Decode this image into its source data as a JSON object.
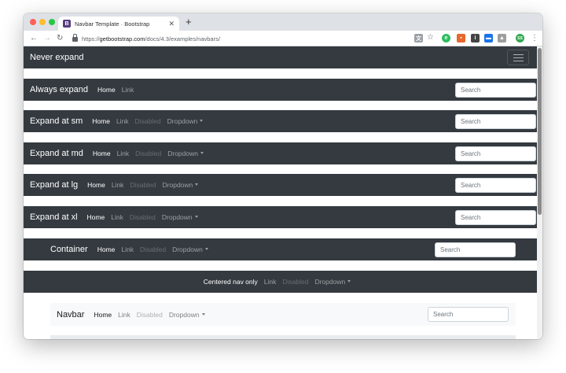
{
  "browser": {
    "tab_title": "Navbar Template · Bootstrap",
    "tab_icon_letter": "B",
    "url_scheme": "https://",
    "url_host": "getbootstrap.com",
    "url_path": "/docs/4.3/examples/navbars/",
    "profile_initials": "SS"
  },
  "navbars": {
    "never": {
      "brand": "Never expand"
    },
    "always": {
      "brand": "Always expand",
      "links": [
        "Home",
        "Link"
      ],
      "search": "Search"
    },
    "sm": {
      "brand": "Expand at sm",
      "links": [
        "Home",
        "Link",
        "Disabled",
        "Dropdown"
      ],
      "search": "Search"
    },
    "md": {
      "brand": "Expand at md",
      "links": [
        "Home",
        "Link",
        "Disabled",
        "Dropdown"
      ],
      "search": "Search"
    },
    "lg": {
      "brand": "Expand at lg",
      "links": [
        "Home",
        "Link",
        "Disabled",
        "Dropdown"
      ],
      "search": "Search"
    },
    "xl": {
      "brand": "Expand at xl",
      "links": [
        "Home",
        "Link",
        "Disabled",
        "Dropdown"
      ],
      "search": "Search"
    },
    "container": {
      "brand": "Container",
      "links": [
        "Home",
        "Link",
        "Disabled",
        "Dropdown"
      ],
      "search": "Search"
    },
    "centered": {
      "links": [
        "Centered nav only",
        "Link",
        "Disabled",
        "Dropdown"
      ]
    },
    "light": {
      "brand": "Navbar",
      "links": [
        "Home",
        "Link",
        "Disabled",
        "Dropdown"
      ],
      "search": "Search"
    }
  },
  "colors": {
    "dark_bg": "#343a40",
    "light_bg": "#f8f9fa",
    "bootstrap_purple": "#563d7c"
  }
}
